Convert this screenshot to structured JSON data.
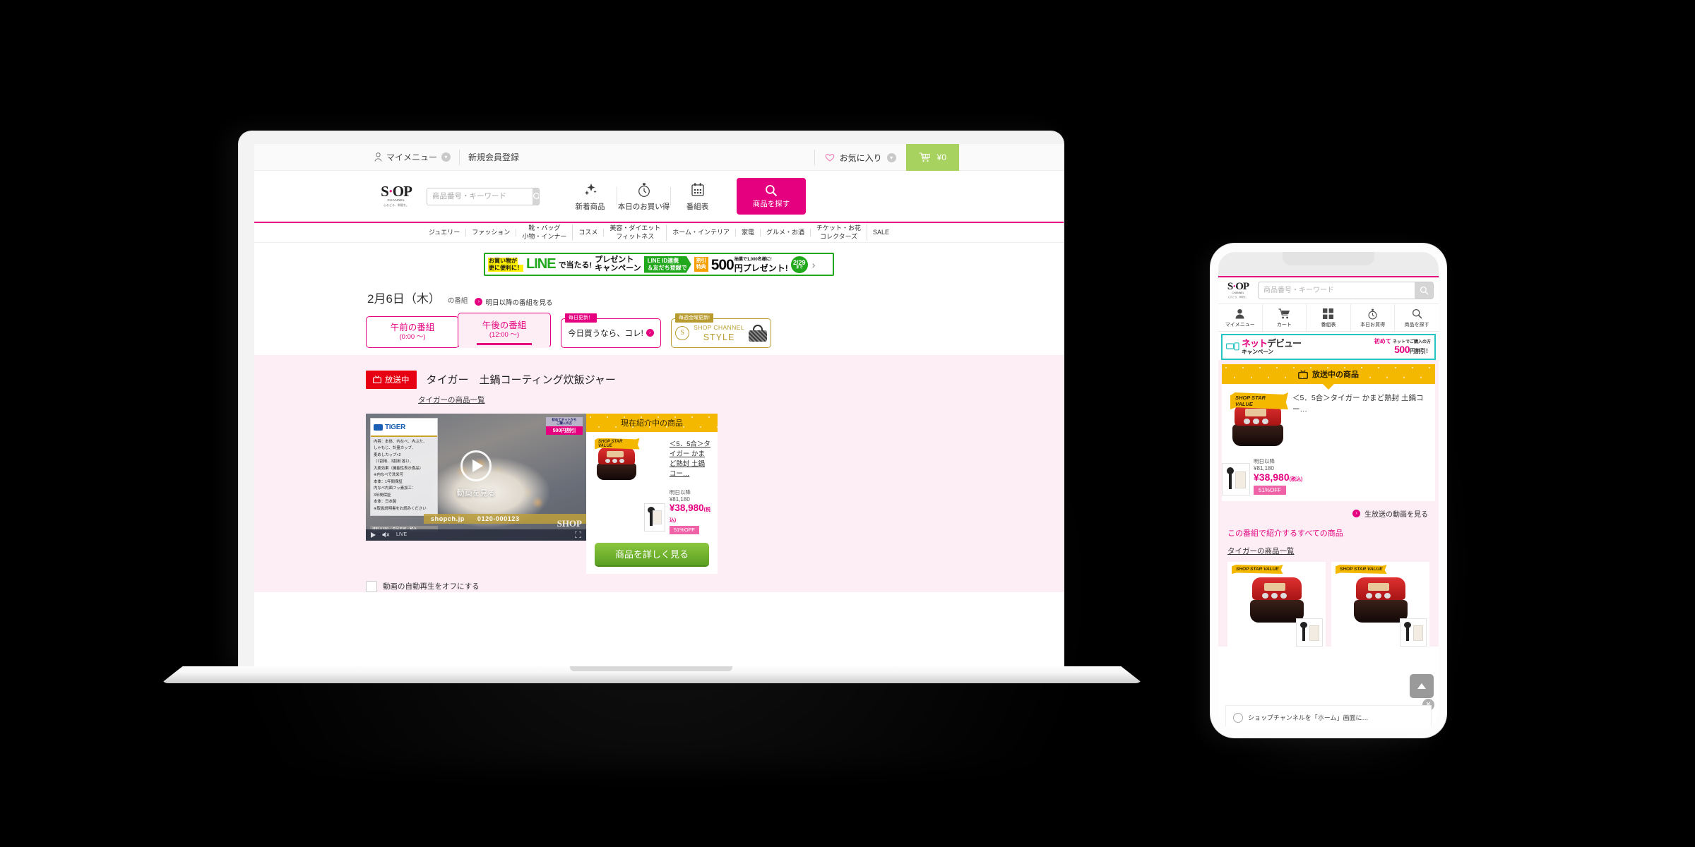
{
  "utility_bar": {
    "my_menu": "マイメニュー",
    "register": "新規会員登録",
    "favorites": "お気に入り",
    "cart_amount": "¥0"
  },
  "header": {
    "brand_name": "SHOP",
    "brand_sub": "CHANNEL",
    "brand_tagline": "心おどる、瞬間を。",
    "search_placeholder": "商品番号・キーワード",
    "search_value": "",
    "links": [
      {
        "label": "新着商品",
        "icon": "sparkle-icon"
      },
      {
        "label": "本日のお買い得",
        "icon": "stopwatch-icon"
      },
      {
        "label": "番組表",
        "icon": "calendar-icon"
      }
    ],
    "search_cta": "商品を探す"
  },
  "nav": {
    "items": [
      "ジュエリー",
      "ファッション",
      "靴・バッグ\n小物・インナー",
      "コスメ",
      "美容・ダイエット\nフィットネス",
      "ホーム・インテリア",
      "家電",
      "グルメ・お酒",
      "チケット・お花\nコレクターズ",
      "SALE"
    ]
  },
  "line_banner": {
    "lead_line1": "お買い物が",
    "lead_line2": "更に便利に！",
    "line_logo": "LINE",
    "de_atar": "で当たる!",
    "present_line1": "プレゼント",
    "present_line2": "キャンペーン",
    "green_line1": "LINE ID連携",
    "green_line2": "＆友だち登録で",
    "orange_line1": "割引",
    "orange_line2": "特典",
    "amount": "500",
    "amount_suffix": "円プレゼント!",
    "lottery_note": "抽選で1,000名様に!",
    "deadline": "2/29",
    "deadline_sub": "(土)",
    "deadline_until": "まで"
  },
  "schedule": {
    "date": "2月6日（木）",
    "date_suffix": "の番組",
    "future_link": "明日以降の番組を見る",
    "tabs": [
      {
        "title": "午前の番組",
        "time": "(0:00 ～)",
        "active": false
      },
      {
        "title": "午後の番組",
        "time": "(12:00 ～)",
        "active": true
      }
    ],
    "promo": {
      "tag": "毎日更新！",
      "text": "今日買うなら、コレ!"
    },
    "style": {
      "tag": "毎週金曜更新!",
      "line1": "SHOP CHANNEL",
      "line2": "STYLE"
    }
  },
  "program": {
    "onair_badge": "放送中",
    "title": "タイガー　土鍋コーティング炊飯ジャー",
    "brand_list_link": "タイガーの商品一覧",
    "autoplay_label": "動画の自動再生をオフにする"
  },
  "video": {
    "brand_overlay": "TIGER",
    "spec_lines": [
      "内容：本体、内なべ、内ぶた、",
      "しゃもじ、計量カップ、",
      "麦めしカップ×2",
      "（1割用、3割用 各1）、",
      "大麦効果（機能性表示食品）",
      "※内なべで洗米可",
      "本体：1年間保証",
      "内なべ内面フッ素加工：",
      "3年間保証",
      "本体：日本製",
      "※取扱説明書をお読みください"
    ],
    "shipping_note": "送料￥660／返品不可／税込",
    "badge_line1": "初めてネットから",
    "badge_line2": "ご購入の方",
    "badge_line3": "500円割引",
    "play_label": "動画を見る",
    "url_text": "shopch.jp",
    "phone_text": "0120-000123",
    "watermark": "SHOP",
    "live_label": "LIVE"
  },
  "side_panel": {
    "header": "現在紹介中の商品",
    "star_badge": "SHOP STAR VALUE",
    "product_title": "＜5．5合＞タイガー かまど熱封 土鍋コー…",
    "was_label": "明日以降",
    "was_price": "¥81,180",
    "now_price": "¥38,980",
    "tax_note": "(税込)",
    "discount": "51%OFF",
    "cta": "商品を詳しく見る"
  },
  "mobile": {
    "brand_name": "SHOP",
    "brand_sub": "CHANNEL",
    "brand_tagline": "心おどる、瞬間を。",
    "search_placeholder": "商品番号・キーワード",
    "search_value": "",
    "nav": [
      {
        "label": "マイメニュー",
        "icon": "person-icon"
      },
      {
        "label": "カート",
        "icon": "cart-icon"
      },
      {
        "label": "番組表",
        "icon": "grid-icon"
      },
      {
        "label": "本日お買得",
        "icon": "stopwatch-icon"
      },
      {
        "label": "商品を探す",
        "icon": "search-icon"
      }
    ],
    "banner": {
      "net": "ネット",
      "debut": "デビュー",
      "campaign": "キャンペーン",
      "first_time": "初めて",
      "first_time_sub": "ネットでご購入の方",
      "amount": "500",
      "amount_suffix": "円割引！"
    },
    "card": {
      "header": "放送中の商品",
      "star_badge": "SHOP STAR VALUE",
      "product_title": "＜5．5合＞タイガー かまど熱封 土鍋コー…",
      "was_label": "明日以降",
      "was_price": "¥81,180",
      "now_price": "¥38,980",
      "tax_note": "(税込)",
      "discount": "51%OFF"
    },
    "live_link": "生放送の動画を見る",
    "section_title": "この番組で紹介するすべての商品",
    "brand_list_link": "タイガーの商品一覧",
    "bottom_sheet_text": "ショップチャンネルを「ホーム」画面に…",
    "scroll_top_icon": "arrow-up-icon",
    "close_icon": "close-icon"
  },
  "colors": {
    "brand_pink": "#e4007f",
    "cart_green": "#a8d25f",
    "cta_green": "#8cc63f",
    "onair_red": "#e60012",
    "gold": "#f5b800",
    "line_green": "#22a81c",
    "teal": "#27c4c4"
  }
}
